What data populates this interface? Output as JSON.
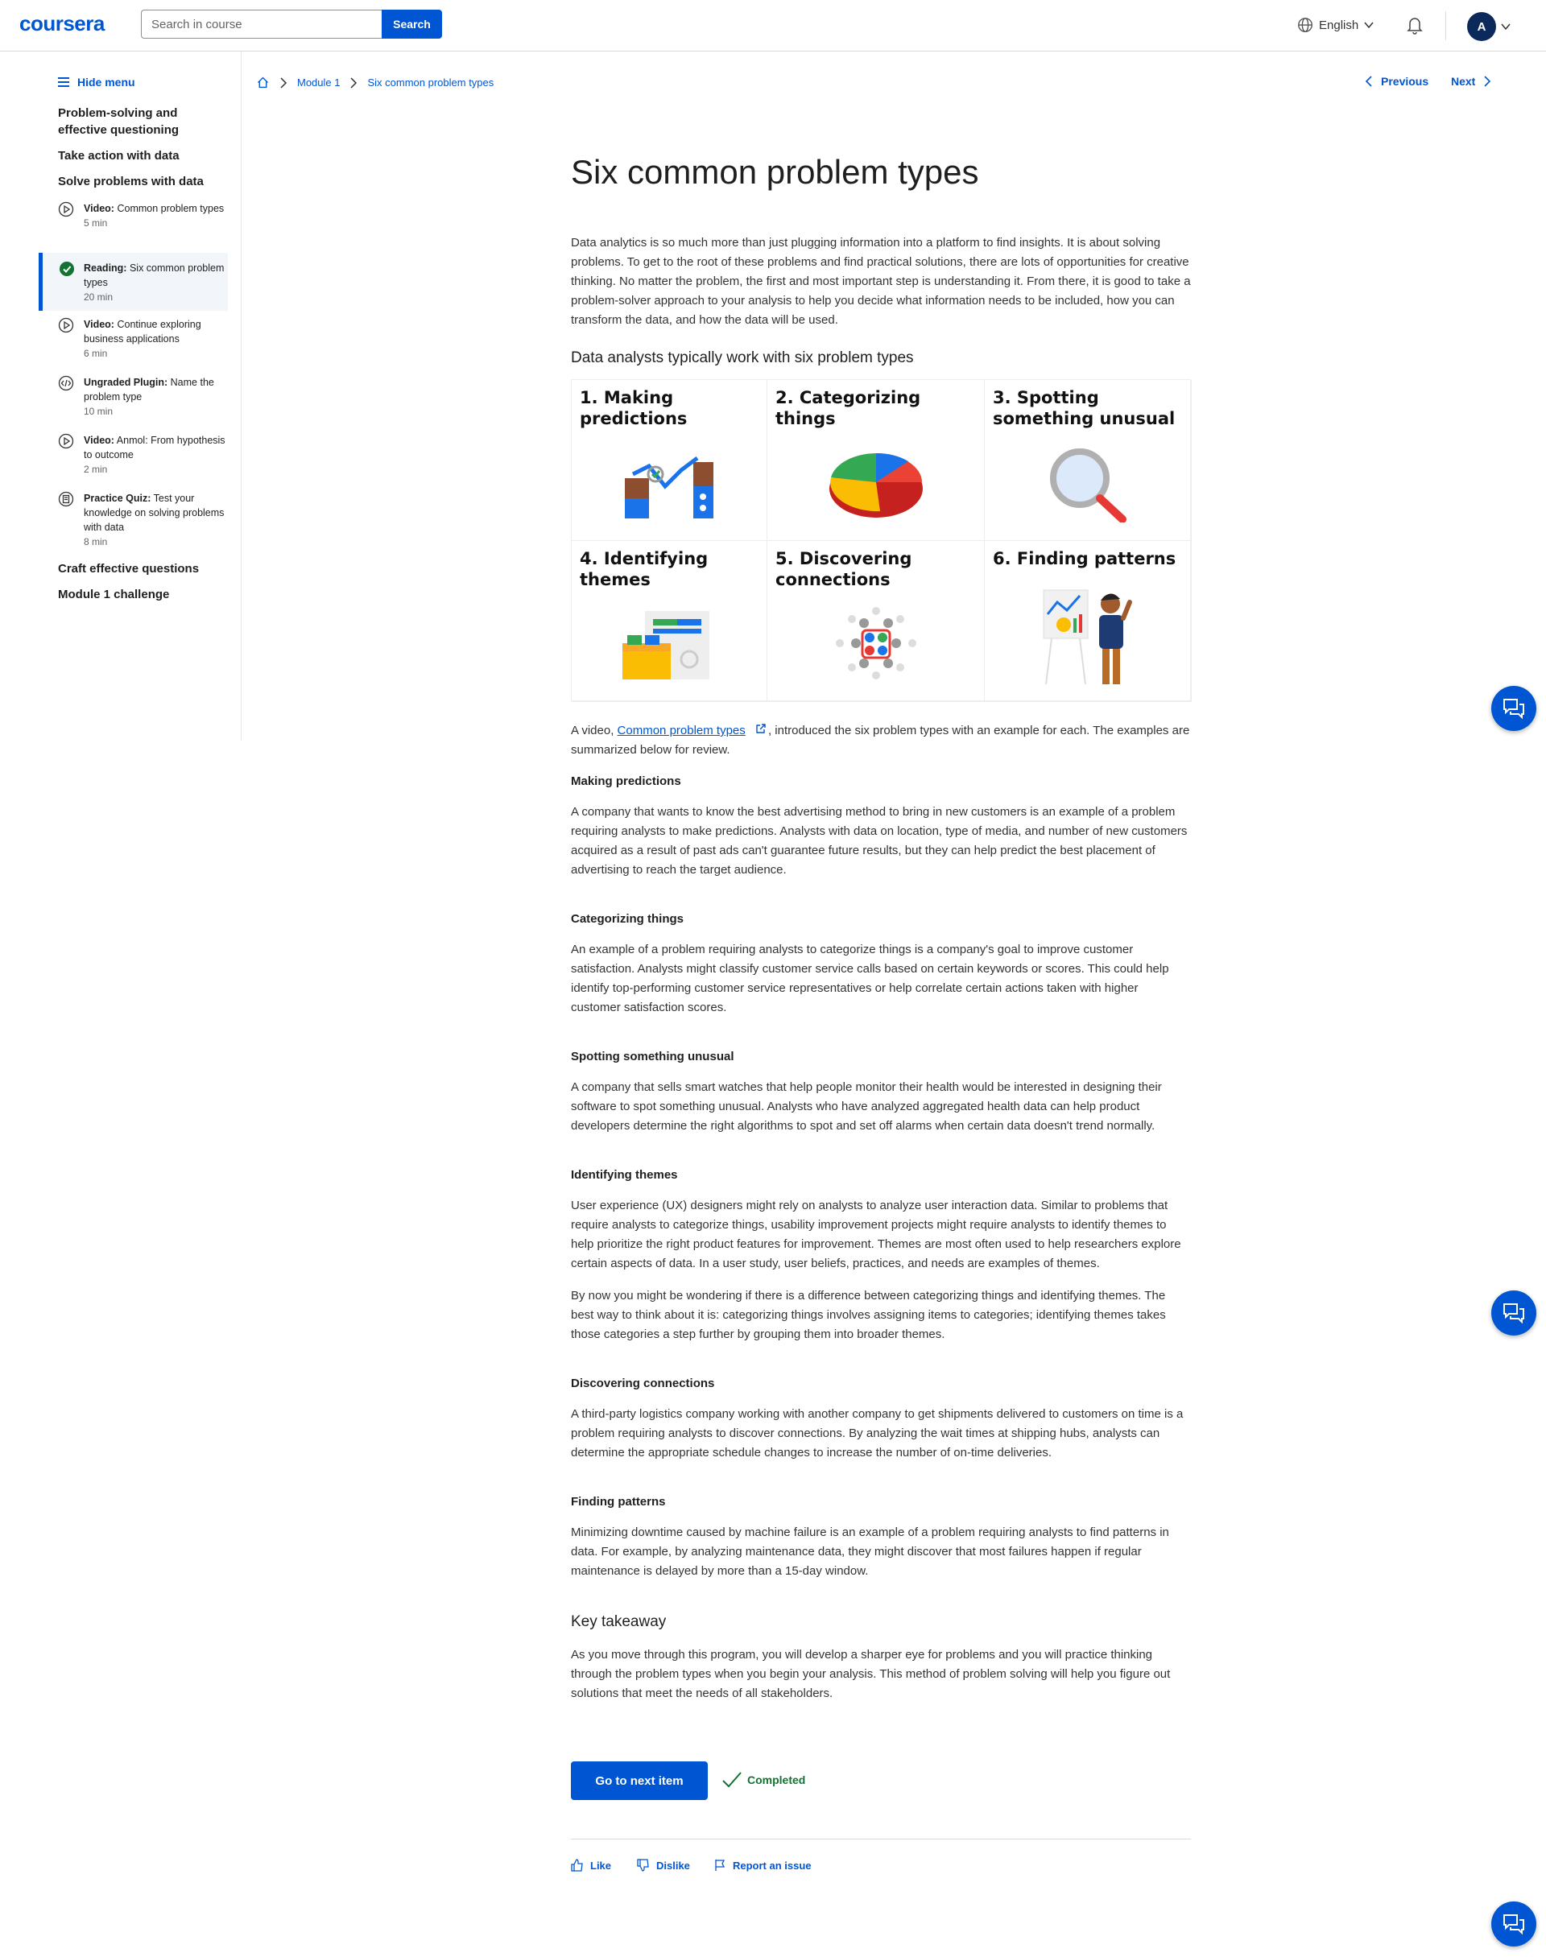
{
  "header": {
    "logo": "coursera",
    "search_placeholder": "Search in course",
    "search_button": "Search",
    "language": "English",
    "avatar_initial": "A"
  },
  "sidebar": {
    "hide_menu": "Hide menu",
    "modules": [
      {
        "title": "Problem-solving and effective questioning"
      },
      {
        "title": "Take action with data"
      },
      {
        "title": "Solve problems with data"
      },
      {
        "title": "Craft effective questions"
      },
      {
        "title": "Module 1 challenge"
      }
    ],
    "items": [
      {
        "type": "Video:",
        "label": "Common problem types",
        "meta": "5 min",
        "icon": "play-circle-icon"
      },
      {
        "type": "Reading:",
        "label": "Six common problem types",
        "meta": "20 min",
        "icon": "completed-check-icon"
      },
      {
        "type": "Video:",
        "label": "Continue exploring business applications",
        "meta": "6 min",
        "icon": "play-circle-icon"
      },
      {
        "type": "Ungraded Plugin:",
        "label": "Name the problem type",
        "meta": "10 min",
        "icon": "plugin-icon"
      },
      {
        "type": "Video:",
        "label": "Anmol: From hypothesis to outcome",
        "meta": "2 min",
        "icon": "play-circle-icon"
      },
      {
        "type": "Practice Quiz:",
        "label": "Test your knowledge on solving problems with data",
        "meta": "8 min",
        "icon": "quiz-icon"
      }
    ]
  },
  "breadcrumb": {
    "module": "Module 1",
    "current": "Six common problem types"
  },
  "nav": {
    "previous": "Previous",
    "next": "Next"
  },
  "content": {
    "title": "Six common problem types",
    "intro": "Data analytics is so much more than just plugging information into a platform to find insights. It is about solving problems. To get to the root of these problems and find practical solutions, there are lots of opportunities for creative thinking. No matter the problem, the first and most important step is understanding it. From there, it is good to take a problem-solver approach to your analysis to help you decide what information needs to be included, how you can transform the data, and how the data will be used.",
    "subtitle": "Data analysts typically work with six problem types",
    "grid": [
      {
        "label": "1. Making predictions"
      },
      {
        "label": "2. Categorizing things"
      },
      {
        "label": "3. Spotting something unusual"
      },
      {
        "label": "4. Identifying themes"
      },
      {
        "label": "5. Discovering connections"
      },
      {
        "label": "6. Finding patterns"
      }
    ],
    "video_prefix": "A  video, ",
    "video_link": "Common problem types",
    "video_suffix": ", introduced the six problem types with an example for each. The examples are summarized below for review.",
    "sections": [
      {
        "heading": "Making predictions",
        "body": "A company that wants to know the best advertising method to bring in new customers is an example of a problem requiring analysts to make predictions. Analysts with data on location, type of media, and number of new customers acquired as a result of past ads can't guarantee future results, but they can help predict the best placement of advertising to reach the target audience."
      },
      {
        "heading": "Categorizing things",
        "body": "An example of a problem requiring analysts to categorize things is a company's goal to improve customer satisfaction. Analysts might classify customer service calls based on certain keywords or scores. This could help identify top-performing customer service representatives or help correlate certain actions taken with higher customer satisfaction scores."
      },
      {
        "heading": "Spotting something unusual",
        "body": "A company that sells smart watches that help people monitor their health would be interested in designing their software to spot something unusual. Analysts who have analyzed aggregated health data can help product developers determine the right algorithms to spot and set off alarms when certain data doesn't trend normally."
      },
      {
        "heading": "Identifying themes",
        "body": "User experience (UX) designers might rely on analysts to analyze user interaction data. Similar to problems that require analysts to categorize things, usability improvement projects might require analysts to identify themes to help prioritize the right product features for improvement. Themes are most often used to help researchers explore certain aspects of data. In a user study, user beliefs, practices, and needs are examples of themes.",
        "body2": "By now you might be wondering if there is a difference between categorizing things and identifying themes. The best way to think about it is: categorizing things involves assigning items to categories; identifying themes takes those categories a step further by grouping them into broader themes."
      },
      {
        "heading": "Discovering connections",
        "body": "A third-party logistics company working with another company to get shipments delivered to customers on time is a problem requiring analysts to discover connections. By analyzing the wait times at shipping hubs, analysts can determine the appropriate schedule changes to increase the number of on-time deliveries."
      },
      {
        "heading": "Finding patterns",
        "body": "Minimizing downtime caused by machine failure is an example of a problem requiring analysts to find patterns in data. For example, by analyzing maintenance data, they might discover that most failures happen if regular maintenance is delayed by more than a 15-day window."
      }
    ],
    "takeaway_heading": "Key takeaway",
    "takeaway_body": "As you move through this program, you will develop a sharper eye for problems and you will practice thinking through the problem types when you begin your analysis. This method of problem solving will help you figure out solutions that meet the needs of all stakeholders."
  },
  "footer": {
    "next_item": "Go to next item",
    "completed": "Completed",
    "like": "Like",
    "dislike": "Dislike",
    "report": "Report an issue"
  },
  "colors": {
    "brand": "#0056d2",
    "success": "#137333"
  }
}
